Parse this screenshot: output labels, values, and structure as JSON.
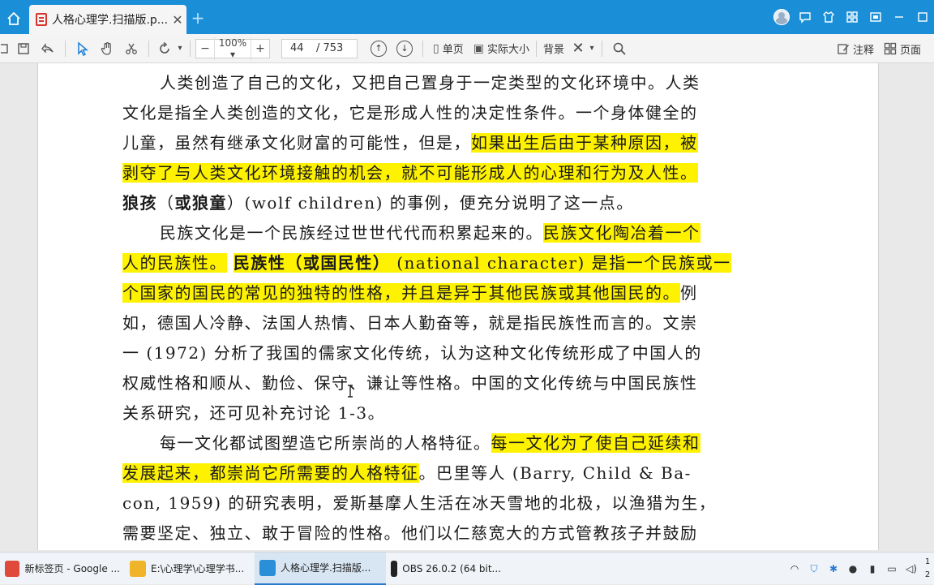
{
  "tabbar": {
    "tab_title": "人格心理学.扫描版.p...",
    "tab_close": "✕",
    "new_tab": "+"
  },
  "toolbar": {
    "zoom_minus": "−",
    "zoom_value": "100%",
    "zoom_caret": "▾",
    "zoom_plus": "+",
    "page_current": "44",
    "page_total": "/ 753",
    "single_page": "单页",
    "actual_size": "实际大小",
    "background": "背景",
    "annotate": "注释",
    "page_view": "页面"
  },
  "document": {
    "lines": [
      {
        "segments": [
          {
            "text": "人类创造了自己的文化，又把自己置身于一定类型的文化环境中。人类"
          }
        ],
        "indent": true
      },
      {
        "segments": [
          {
            "text": "文化是指全人类创造的文化，它是形成人性的决定性条件。一个身体健全的"
          }
        ]
      },
      {
        "segments": [
          {
            "text": "儿童，虽然有继承文化财富的可能性，但是，"
          },
          {
            "text": "如果出生后由于某种原因，被",
            "hl": true
          }
        ]
      },
      {
        "segments": [
          {
            "text": "剥夺了与人类文化环境接触的机会，就不可能形成人的心理和行为及人性。",
            "hl": true
          }
        ]
      },
      {
        "segments": [
          {
            "text": "狼孩",
            "bold": true
          },
          {
            "text": "（"
          },
          {
            "text": "或狼童",
            "bold": true
          },
          {
            "text": "）(wolf children) 的事例，便充分说明了这一点。"
          }
        ]
      },
      {
        "segments": [
          {
            "text": "民族文化是一个民族经过世世代代而积累起来的。"
          },
          {
            "text": "民族文化陶冶着一个",
            "hl": true
          }
        ],
        "indent": true
      },
      {
        "segments": [
          {
            "text": "人的民族性。",
            "hl": true
          },
          {
            "text": " "
          },
          {
            "text": "民族性（或国民性）",
            "hl": true,
            "bold": true
          },
          {
            "text": " (national character) 是指一个民族或一",
            "hl": true
          }
        ]
      },
      {
        "segments": [
          {
            "text": "个国家的国民的常见的独特的性格，并且是异于其他民族或其他国民的。",
            "hl": true
          },
          {
            "text": "例"
          }
        ]
      },
      {
        "segments": [
          {
            "text": "如，德国人冷静、法国人热情、日本人勤奋等，就是指民族性而言的。文崇"
          }
        ]
      },
      {
        "segments": [
          {
            "text": "一 (1972) 分析了我国的儒家文化传统，认为这种文化传统形成了中国人的"
          }
        ]
      },
      {
        "segments": [
          {
            "text": "权威性格和顺从、勤俭、保守、谦让等性格。中国的文化传统与中国民族性"
          }
        ]
      },
      {
        "segments": [
          {
            "text": "关系研究，还可见补充讨论 1-3。"
          }
        ]
      },
      {
        "segments": [
          {
            "text": "每一文化都试图塑造它所崇尚的人格特征。"
          },
          {
            "text": "每一文化为了使自己延续和",
            "hl": true
          }
        ],
        "indent": true
      },
      {
        "segments": [
          {
            "text": "发展起来，都崇尚它所需要的人格特征",
            "hl": true
          },
          {
            "text": "。巴里等人 (Barry, Child & Ba-"
          }
        ]
      },
      {
        "segments": [
          {
            "text": "con, 1959) 的研究表明，爱斯基摩人生活在冰天雪地的北极，以渔猎为生，"
          }
        ]
      },
      {
        "segments": [
          {
            "text": "需要坚定、独立、敢于冒险的性格。他们以仁慈宽大的方式管教孩子并鼓励"
          }
        ]
      }
    ]
  },
  "taskbar": {
    "items": [
      {
        "label": "新标签页 - Google ...",
        "color": "#e04a3a"
      },
      {
        "label": "E:\\心理学\\心理学书...",
        "color": "#f0b429"
      },
      {
        "label": "人格心理学.扫描版...",
        "color": "#2a8fd8"
      },
      {
        "label": "OBS 26.0.2 (64 bit...",
        "color": "#222222"
      }
    ],
    "clock_line1": "1",
    "clock_line2": "2"
  }
}
